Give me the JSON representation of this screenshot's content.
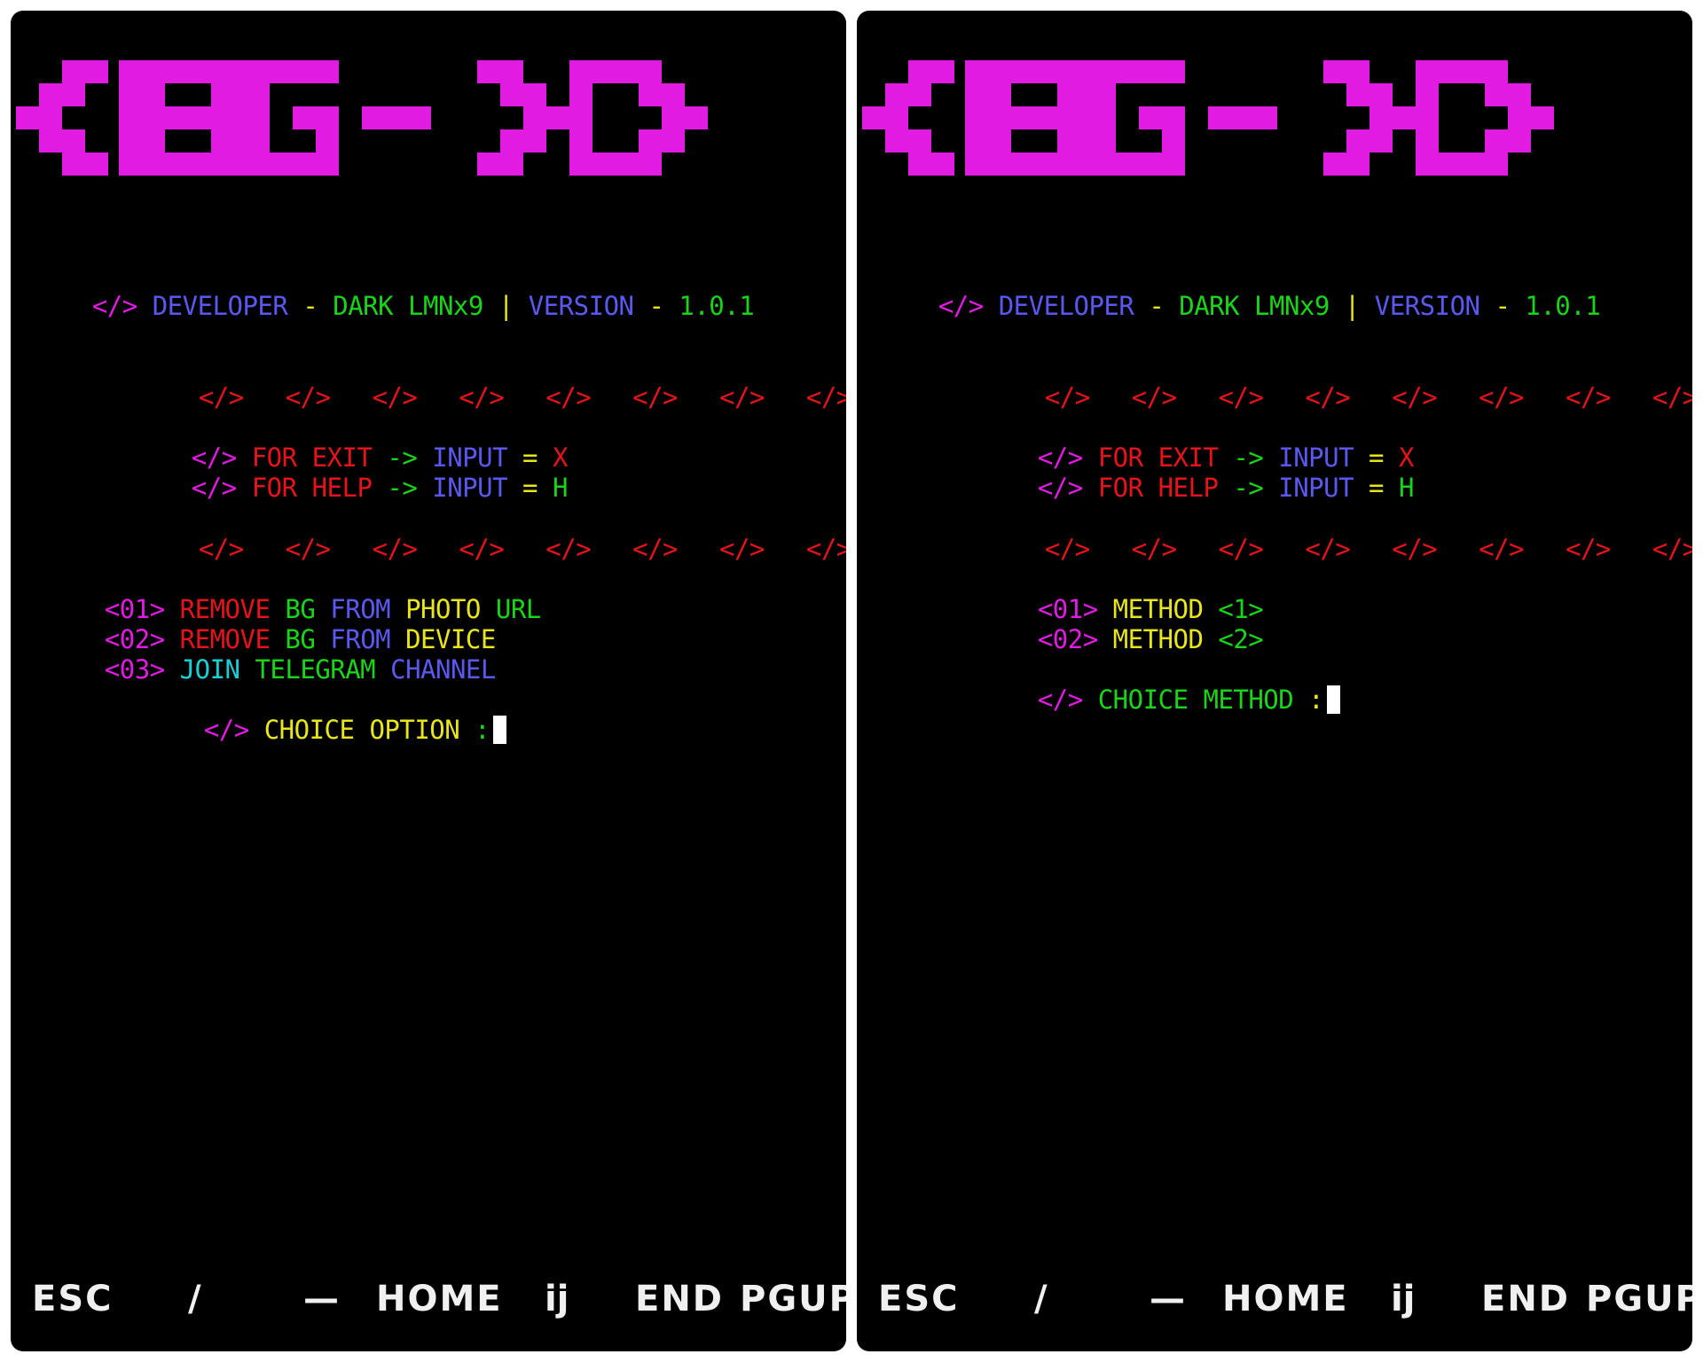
{
  "colors": {
    "magenta": "#e21be2",
    "red": "#e5141c",
    "blue": "#5a58ee",
    "green": "#19d419",
    "yellow": "#e8e51a",
    "cyan": "#19cfd4",
    "white": "#f0f0f0",
    "background": "#000000"
  },
  "banner": {
    "text": "{BG - X}",
    "color": "#e21be2"
  },
  "developer_line": {
    "tag": "</>",
    "developer_label": "DEVELOPER",
    "dash1": "-",
    "developer_name": "DARK LMNx9",
    "separator": "|",
    "version_label": "VERSION",
    "dash2": "-",
    "version_value": "1.0.1"
  },
  "divider": [
    "</>",
    "</>",
    "</>",
    "</>",
    "</>",
    "</>",
    "</>",
    "</>",
    "</>",
    "</>"
  ],
  "help": {
    "exit": {
      "tag": "</>",
      "for": "FOR",
      "word": "EXIT",
      "arrow": "->",
      "input": "INPUT",
      "eq": "=",
      "key": "X"
    },
    "help": {
      "tag": "</>",
      "for": "FOR",
      "word": "HELP",
      "arrow": "->",
      "input": "INPUT",
      "eq": "=",
      "key": "H"
    }
  },
  "left_menu": {
    "options": [
      {
        "num": "<01>",
        "w1": "REMOVE",
        "w2": "BG",
        "w3": "FROM",
        "w4": "PHOTO",
        "w5": "URL"
      },
      {
        "num": "<02>",
        "w1": "REMOVE",
        "w2": "BG",
        "w3": "FROM",
        "w4": "DEVICE"
      },
      {
        "num": "<03>",
        "w1": "JOIN",
        "w2": "TELEGRAM",
        "w3": "CHANNEL"
      }
    ],
    "prompt": {
      "tag": "</>",
      "w1": "CHOICE",
      "w2": "OPTION",
      "colon": ":"
    }
  },
  "right_menu": {
    "methods": [
      {
        "num": "<01>",
        "label": "METHOD",
        "value": "<1>"
      },
      {
        "num": "<02>",
        "label": "METHOD",
        "value": "<2>"
      }
    ],
    "prompt": {
      "tag": "</>",
      "w1": "CHOICE",
      "w2": "METHOD",
      "colon": ":"
    }
  },
  "keys": {
    "esc": "ESC",
    "slash": "/",
    "dash": "—",
    "home": "HOME",
    "arrow_up": "ĳ",
    "end": "END",
    "pgup": "PGUP"
  }
}
